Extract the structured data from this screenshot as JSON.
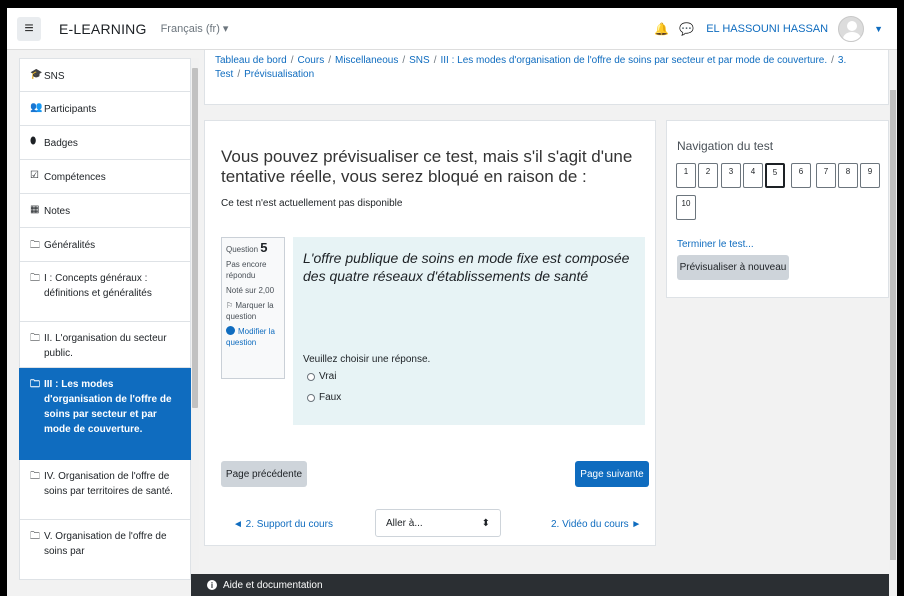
{
  "navbar": {
    "menu_icon": "hamburger-icon",
    "brand": "E-LEARNING",
    "language": "Français (fr) ▾",
    "user_name": "EL HASSOUNI HASSAN",
    "icons": [
      "bell-icon",
      "chat-icon"
    ]
  },
  "sidebar": {
    "items": [
      {
        "icon": "graduation-cap-icon",
        "glyph": "🎓",
        "label": "SNS"
      },
      {
        "icon": "users-icon",
        "glyph": "👥",
        "label": "Participants"
      },
      {
        "icon": "badge-icon",
        "glyph": "⬮",
        "label": "Badges"
      },
      {
        "icon": "checkbox-icon",
        "glyph": "☑",
        "label": "Compétences"
      },
      {
        "icon": "table-icon",
        "glyph": "▦",
        "label": "Notes"
      },
      {
        "icon": "folder-icon",
        "glyph": "🗀",
        "label": "Généralités"
      },
      {
        "icon": "folder-icon",
        "glyph": "🗀",
        "label": "I : Concepts généraux : définitions et généralités"
      },
      {
        "icon": "folder-icon",
        "glyph": "🗀",
        "label": "II. L'organisation du secteur public."
      },
      {
        "icon": "folder-icon",
        "glyph": "🗀",
        "label": "III : Les modes d'organisation de l'offre de soins par secteur et par mode de couverture."
      },
      {
        "icon": "folder-icon",
        "glyph": "🗀",
        "label": "IV. Organisation de l'offre de soins par territoires de santé."
      },
      {
        "icon": "folder-icon",
        "glyph": "🗀",
        "label": "V. Organisation de l'offre de soins par"
      }
    ],
    "active_index": 8
  },
  "breadcrumb": [
    "Tableau de bord",
    "Cours",
    "Miscellaneous",
    "SNS",
    "III : Les modes d'organisation de l'offre de soins par secteur et par mode de couverture.",
    "3. Test",
    "Prévisualisation"
  ],
  "main": {
    "preview_message": "Vous pouvez prévisualiser ce test, mais s'il s'agit d'une tentative réelle, vous serez bloqué en raison de :",
    "unavailable": "Ce test n'est actuellement pas disponible",
    "question_info": {
      "label": "Question",
      "number": "5",
      "state": "Pas encore répondu",
      "mark": "Noté sur 2,00",
      "flag": "⚐ Marquer la question",
      "edit": "Modifier la question"
    },
    "question_text": "L'offre publique de soins en mode fixe est composée des quatre réseaux d'établissements de santé",
    "prompt": "Veuillez choisir une réponse.",
    "options": [
      "Vrai",
      "Faux"
    ],
    "prev_page": "Page précédente",
    "next_page": "Page suivante",
    "prev_activity": "◄ 2. Support du cours",
    "jump_to": "Aller à...",
    "jump_caret": "⬍",
    "next_activity": "2. Vidéo du cours ►"
  },
  "quiz_nav": {
    "title": "Navigation du test",
    "buttons": [
      "1",
      "2",
      "3",
      "4",
      "5",
      "6",
      "7",
      "8",
      "9",
      "10"
    ],
    "current": "5",
    "finish": "Terminer le test...",
    "restart": "Prévisualiser à nouveau"
  },
  "footer": {
    "help": "Aide et documentation"
  },
  "colors": {
    "accent": "#0f6cbf",
    "question_bg": "#e7f3f5",
    "footer_bg": "#2b2f33"
  }
}
